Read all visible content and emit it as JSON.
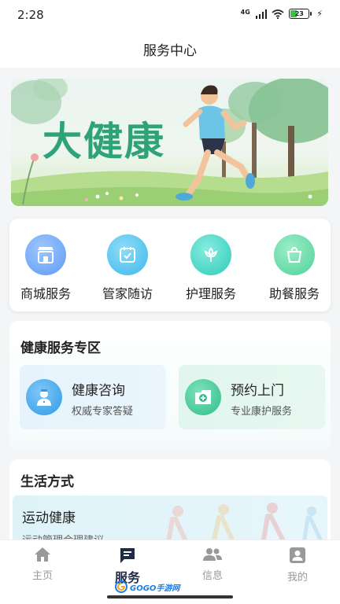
{
  "status_bar": {
    "time": "2:28",
    "network": "4G",
    "battery": "23"
  },
  "nav": {
    "title": "服务中心"
  },
  "banner": {
    "title": "大健康"
  },
  "quick_actions": [
    {
      "label": "商城服务",
      "icon": "store-icon"
    },
    {
      "label": "管家随访",
      "icon": "calendar-check-icon"
    },
    {
      "label": "护理服务",
      "icon": "flower-care-icon"
    },
    {
      "label": "助餐服务",
      "icon": "shopping-bag-icon"
    }
  ],
  "health_zone": {
    "title": "健康服务专区",
    "services": [
      {
        "title": "健康咨询",
        "subtitle": "权威专家答疑",
        "icon": "doctor-icon"
      },
      {
        "title": "预约上门",
        "subtitle": "专业康护服务",
        "icon": "medical-kit-icon"
      }
    ]
  },
  "lifestyle": {
    "title": "生活方式",
    "banner_title": "运动健康",
    "banner_subtitle": "运动管理合理建议"
  },
  "tabs": [
    {
      "label": "主页",
      "icon": "home-icon"
    },
    {
      "label": "服务",
      "icon": "message-list-icon",
      "active": true
    },
    {
      "label": "信息",
      "icon": "people-icon"
    },
    {
      "label": "我的",
      "icon": "profile-icon"
    }
  ],
  "watermark": {
    "text": "GOGO手游网"
  },
  "colors": {
    "accent_green": "#2fa27a",
    "quick_blue": "#6aa8f5",
    "quick_cyan": "#4fc4ee",
    "quick_teal": "#3fd6c3",
    "quick_mint": "#5ed9a6",
    "tab_active": "#1f2a44",
    "tab_inactive": "#999999"
  }
}
